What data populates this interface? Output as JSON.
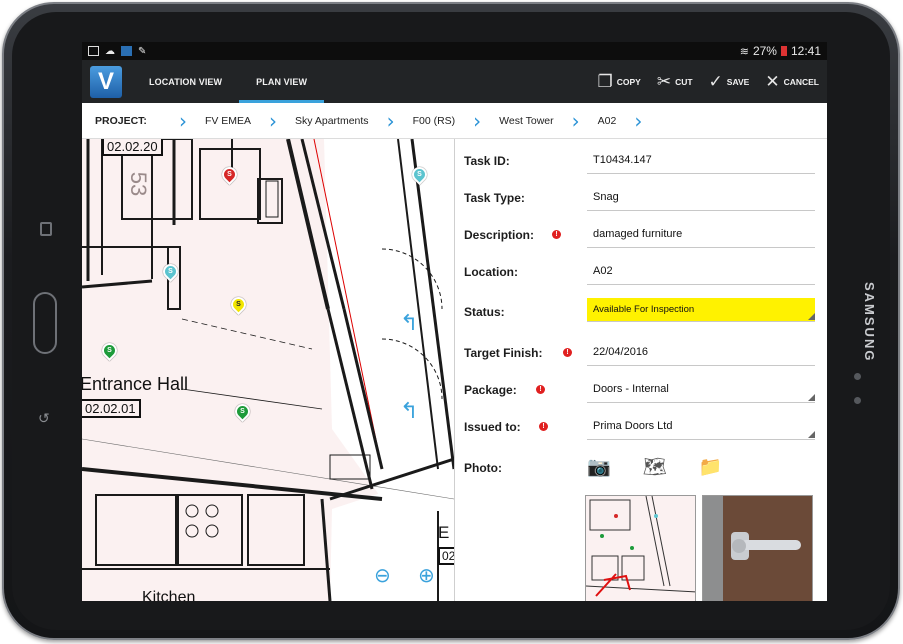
{
  "device": {
    "brand": "SAMSUNG"
  },
  "statusbar": {
    "battery": "27%",
    "time": "12:41"
  },
  "appbar": {
    "logo": "V",
    "tabs": [
      {
        "label": "LOCATION VIEW"
      },
      {
        "label": "PLAN VIEW"
      }
    ],
    "actions": [
      {
        "label": "COPY",
        "icon": "copy-icon"
      },
      {
        "label": "CUT",
        "icon": "cut-icon"
      },
      {
        "label": "SAVE",
        "icon": "check-icon"
      },
      {
        "label": "CANCEL",
        "icon": "close-icon"
      }
    ]
  },
  "breadcrumb": {
    "label": "PROJECT:",
    "items": [
      "FV EMEA",
      "Sky Apartments",
      "F00 (RS)",
      "West Tower",
      "A02"
    ]
  },
  "plan": {
    "labels": {
      "room1": "02.02.20",
      "room2": "Entrance Hall",
      "room3": "02.02.01",
      "room4": "Kitchen",
      "room5": "E",
      "room6": "02",
      "room7": "53"
    },
    "pins": [
      {
        "letter": "S",
        "color": "#d62828"
      },
      {
        "letter": "S",
        "color": "#5cc4cf"
      },
      {
        "letter": "S",
        "color": "#5cc4cf"
      },
      {
        "letter": "S",
        "color": "#f2e600"
      },
      {
        "letter": "S",
        "color": "#1d9b3a"
      },
      {
        "letter": "S",
        "color": "#1d9b3a"
      }
    ]
  },
  "form": {
    "task_id": {
      "label": "Task ID:",
      "value": "T10434.147"
    },
    "task_type": {
      "label": "Task Type:",
      "value": "Snag"
    },
    "description": {
      "label": "Description:",
      "value": "damaged furniture"
    },
    "location": {
      "label": "Location:",
      "value": "A02"
    },
    "status": {
      "label": "Status:",
      "value": "Available For Inspection",
      "color": "#fff200"
    },
    "target_finish": {
      "label": "Target Finish:",
      "value": "22/04/2016"
    },
    "package": {
      "label": "Package:",
      "value": "Doors - Internal"
    },
    "issued_to": {
      "label": "Issued to:",
      "value": "Prima Doors Ltd"
    },
    "photo": {
      "label": "Photo:"
    },
    "required_mark": "!"
  },
  "colors": {
    "accent": "#3aa2dc",
    "appbar": "#222426"
  }
}
